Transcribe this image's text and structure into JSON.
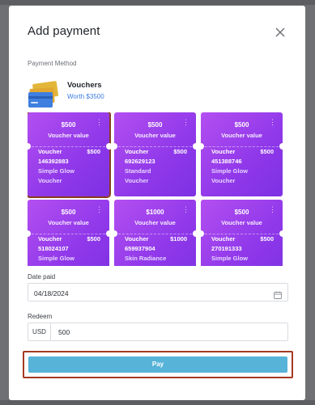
{
  "modal": {
    "title": "Add payment",
    "payment_method_label": "Payment Method",
    "method": {
      "name": "Vouchers",
      "worth": "Worth $3500",
      "icon": "cards-icon"
    }
  },
  "vouchers": [
    {
      "amount": "$500",
      "caption": "Voucher value",
      "label": "Voucher",
      "right_amount": "$500",
      "code": "146392883",
      "name": "Simple Glow",
      "type": "Voucher",
      "selected": true
    },
    {
      "amount": "$500",
      "caption": "Voucher value",
      "label": "Voucher",
      "right_amount": "$500",
      "code": "692629123",
      "name": "Standard",
      "type": "Voucher",
      "selected": false
    },
    {
      "amount": "$500",
      "caption": "Voucher value",
      "label": "Voucher",
      "right_amount": "$500",
      "code": "451388746",
      "name": "Simple Glow",
      "type": "Voucher",
      "selected": false
    },
    {
      "amount": "$500",
      "caption": "Voucher value",
      "label": "Voucher",
      "right_amount": "$500",
      "code": "518024107",
      "name": "Simple Glow",
      "type": "",
      "selected": false
    },
    {
      "amount": "$1000",
      "caption": "Voucher value",
      "label": "Voucher",
      "right_amount": "$1000",
      "code": "659937904",
      "name": "Skin Radiance",
      "type": "",
      "selected": false
    },
    {
      "amount": "$500",
      "caption": "Voucher value",
      "label": "Voucher",
      "right_amount": "$500",
      "code": "270191333",
      "name": "Simple Glow",
      "type": "",
      "selected": false
    }
  ],
  "date_paid": {
    "label": "Date paid",
    "value": "04/18/2024"
  },
  "redeem": {
    "label": "Redeem",
    "currency": "USD",
    "value": "500"
  },
  "pay_button": {
    "label": "Pay"
  },
  "colors": {
    "voucher_start": "#b34ff0",
    "voucher_end": "#7d31e2",
    "pay_button": "#57b3d8",
    "link_blue": "#3d7de4",
    "selection_outline": "#8a3b1e"
  }
}
